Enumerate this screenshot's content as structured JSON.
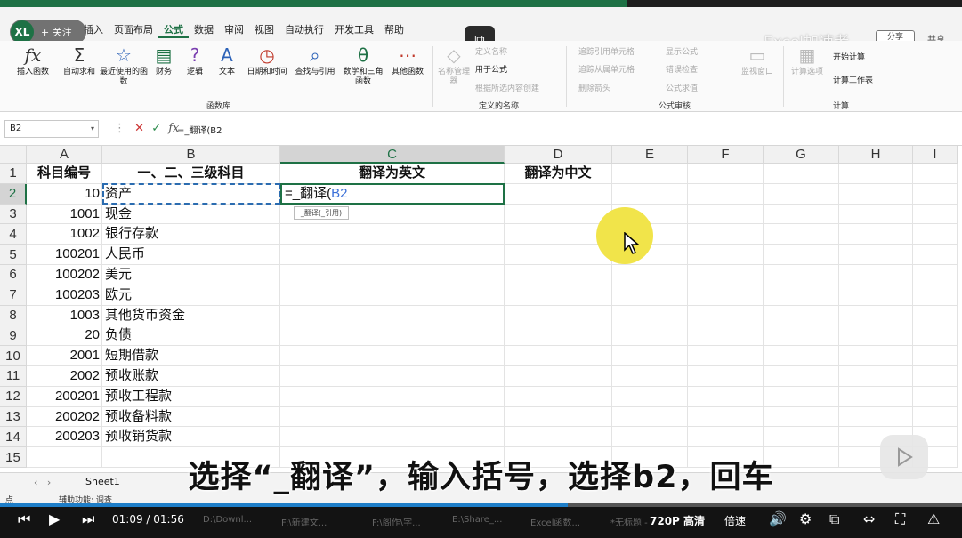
{
  "menubar": {
    "follow_label": "+ 关注",
    "avatar_text": "XL",
    "items": [
      "插入",
      "页面布局",
      "公式",
      "数据",
      "审阅",
      "视图",
      "自动执行",
      "开发工具",
      "帮助"
    ],
    "active": "公式",
    "watermark": "Excel加速者",
    "share_label": "分享",
    "share_right": "共享"
  },
  "ribbon": {
    "function_library": {
      "buttons": [
        {
          "label": "插入函数",
          "icon": "fx"
        },
        {
          "label": "自动求和",
          "icon": "Σ"
        },
        {
          "label": "最近使用的函数",
          "icon": "☆"
        },
        {
          "label": "财务",
          "icon": "▤"
        },
        {
          "label": "逻辑",
          "icon": "?"
        },
        {
          "label": "文本",
          "icon": "A"
        },
        {
          "label": "日期和时间",
          "icon": "◷"
        },
        {
          "label": "查找与引用",
          "icon": "⌕"
        },
        {
          "label": "数学和三角函数",
          "icon": "θ"
        },
        {
          "label": "其他函数",
          "icon": "⋯"
        }
      ],
      "group_label": "函数库"
    },
    "defined_names": {
      "name_manager": "名称管理器",
      "define_name": "定义名称",
      "use_in_formula": "用于公式",
      "create_from_selection": "根据所选内容创建",
      "group_label": "定义的名称"
    },
    "formula_auditing": {
      "trace_precedents": "追踪引用单元格",
      "trace_dependents": "追踪从属单元格",
      "remove_arrows": "删除箭头",
      "show_formulas": "显示公式",
      "error_checking": "错误检查",
      "evaluate_formula": "公式求值",
      "watch_window": "监视窗口",
      "group_label": "公式审核"
    },
    "calculation": {
      "calc_options": "计算选项",
      "calc_now": "开始计算",
      "calc_sheet": "计算工作表",
      "group_label": "计算"
    }
  },
  "formula_bar": {
    "name_box": "B2",
    "formula": "=_翻译(B2"
  },
  "grid": {
    "columns": [
      "A",
      "B",
      "C",
      "D",
      "E",
      "F",
      "G",
      "H",
      "I"
    ],
    "selected_column": "C",
    "selected_row": "2",
    "rows": [
      {
        "n": "1",
        "a": "科目编号",
        "b": "一、二、三级科目",
        "c": "翻译为英文",
        "d": "翻译为中文"
      },
      {
        "n": "2",
        "a": "10",
        "b": "资产",
        "c": "",
        "d": ""
      },
      {
        "n": "3",
        "a": "1001",
        "b": "现金",
        "c": "",
        "d": ""
      },
      {
        "n": "4",
        "a": "1002",
        "b": "银行存款",
        "c": "",
        "d": ""
      },
      {
        "n": "5",
        "a": "100201",
        "b": "人民币",
        "c": "",
        "d": ""
      },
      {
        "n": "6",
        "a": "100202",
        "b": "美元",
        "c": "",
        "d": ""
      },
      {
        "n": "7",
        "a": "100203",
        "b": "欧元",
        "c": "",
        "d": ""
      },
      {
        "n": "8",
        "a": "1003",
        "b": "其他货币资金",
        "c": "",
        "d": ""
      },
      {
        "n": "9",
        "a": "20",
        "b": "负债",
        "c": "",
        "d": ""
      },
      {
        "n": "10",
        "a": "2001",
        "b": "短期借款",
        "c": "",
        "d": ""
      },
      {
        "n": "11",
        "a": "2002",
        "b": "预收账款",
        "c": "",
        "d": ""
      },
      {
        "n": "12",
        "a": "200201",
        "b": "预收工程款",
        "c": "",
        "d": ""
      },
      {
        "n": "13",
        "a": "200202",
        "b": "预收备料款",
        "c": "",
        "d": ""
      },
      {
        "n": "14",
        "a": "200203",
        "b": "预收销货款",
        "c": "",
        "d": ""
      },
      {
        "n": "15",
        "a": "",
        "b": "",
        "c": "",
        "d": ""
      }
    ],
    "editing_prefix": "=_翻译(",
    "editing_ref": "B2",
    "tooltip": "_翻译(_引用)"
  },
  "sheets": {
    "tab": "Sheet1"
  },
  "status": {
    "mode": "点",
    "accessibility": "辅助功能: 调查"
  },
  "subtitle": "选择“_翻译”，输入括号，选择b2，回车",
  "player": {
    "current_time": "01:09",
    "total_time": "01:56",
    "progress": 0.59,
    "quality": "720P 高清",
    "speed_label": "倍速"
  },
  "taskbar": {
    "items": [
      "D:\\Downl...",
      "F:\\新建文...",
      "F:\\阁作\\字...",
      "E:\\Share_...",
      "Excel函数...",
      "*无标题 -"
    ]
  },
  "colors": {
    "excel_green": "#1e7145",
    "highlight_yellow": "#f1e44a",
    "ref_blue": "#3a6fd8",
    "progress_blue": "#1e7ec8"
  }
}
